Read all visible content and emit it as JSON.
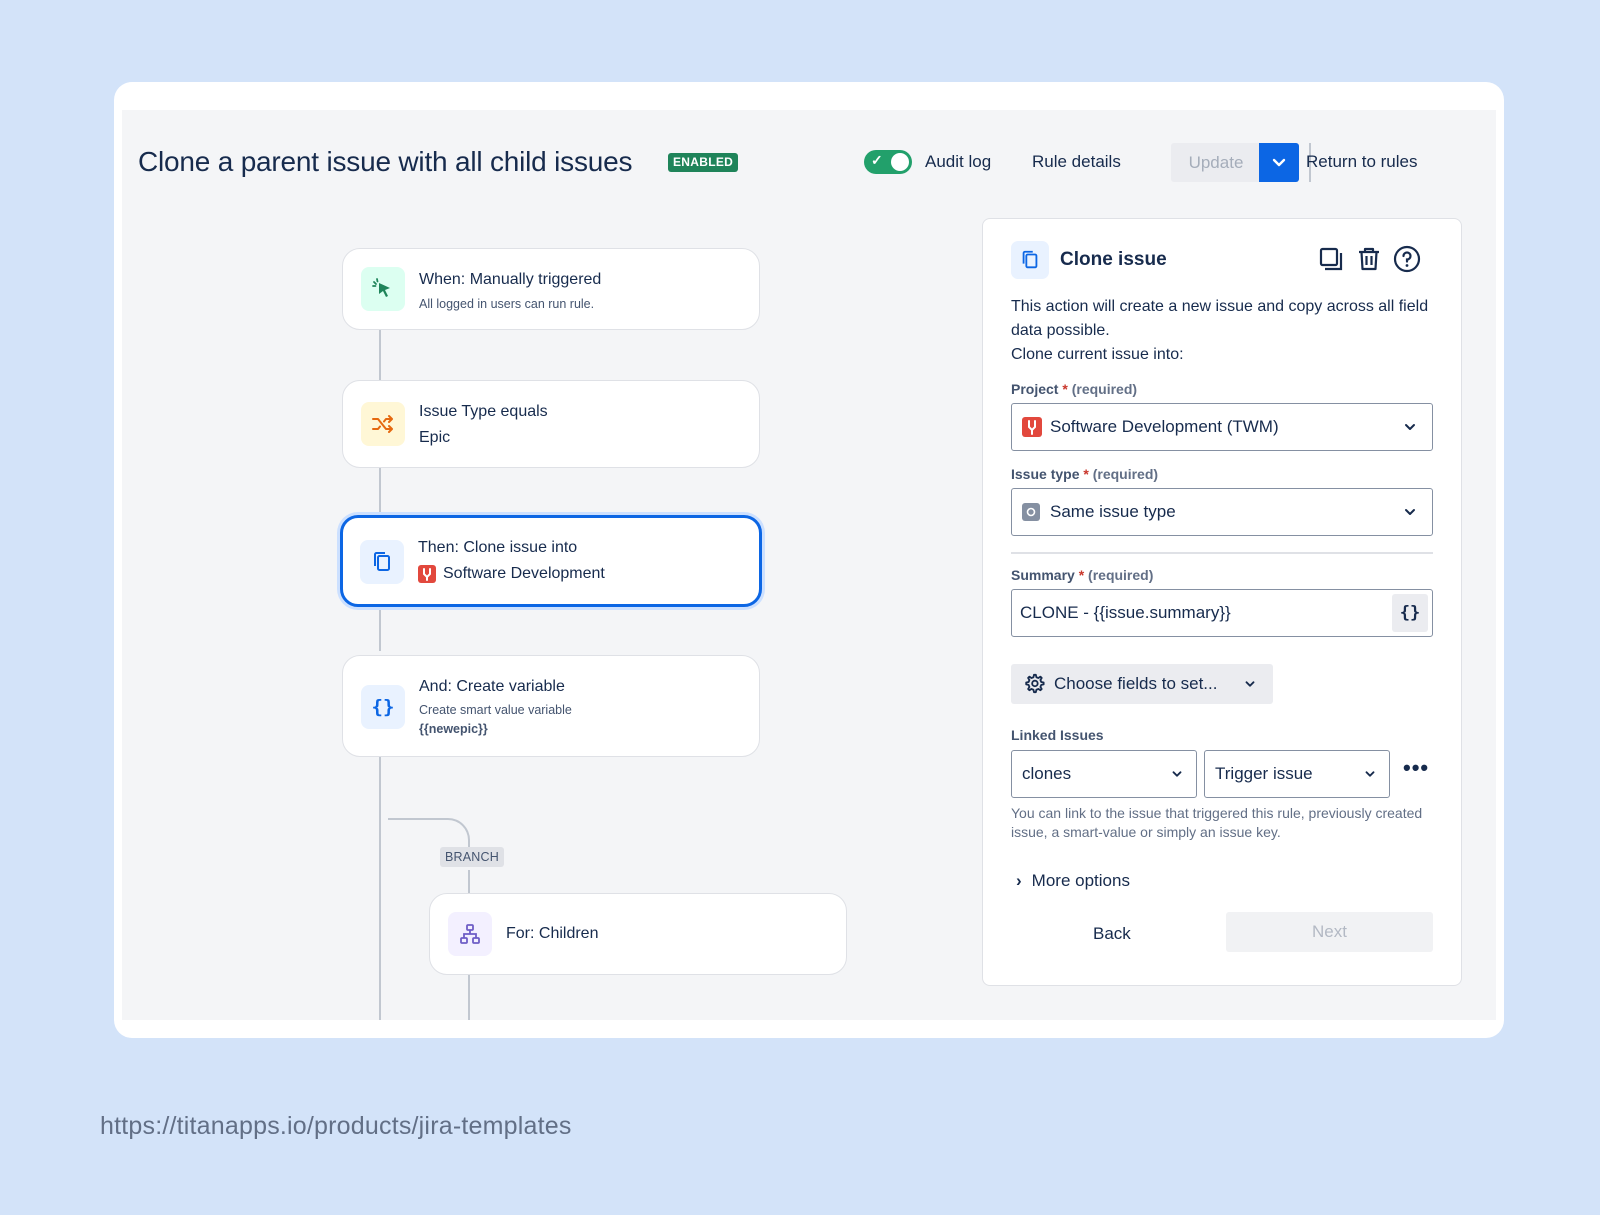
{
  "header": {
    "title": "Clone a parent issue with all child issues",
    "status_badge": "ENABLED",
    "audit_log": "Audit log",
    "rule_details": "Rule details",
    "update": "Update",
    "return_to_rules": "Return to rules",
    "toggle_on": true
  },
  "flow": {
    "trigger": {
      "title": "When: Manually triggered",
      "subtitle": "All logged in users can run rule."
    },
    "condition": {
      "title": "Issue Type equals",
      "value": "Epic"
    },
    "action": {
      "title": "Then: Clone issue into",
      "project": "Software Development"
    },
    "variable": {
      "title": "And: Create variable",
      "subtitle": "Create smart value variable",
      "value": "{{newepic}}"
    },
    "branch_label": "BRANCH",
    "branch": {
      "title": "For: Children"
    }
  },
  "panel": {
    "title": "Clone issue",
    "description_line1": "This action will create a new issue and copy across all field data possible.",
    "description_line2": "Clone current issue into:",
    "project_label": "Project",
    "required_text": "(required)",
    "project_value": "Software Development (TWM)",
    "issue_type_label": "Issue type",
    "issue_type_value": "Same issue type",
    "summary_label": "Summary",
    "summary_value": "CLONE - {{issue.summary}}",
    "smart_value_button": "{}",
    "choose_fields": "Choose fields to set...",
    "linked_issues_label": "Linked Issues",
    "link_type": "clones",
    "link_target": "Trigger issue",
    "more_actions": "•••",
    "help_text": "You can link to the issue that triggered this rule, previously created issue, a smart-value or simply an issue key.",
    "more_options": "More options",
    "back": "Back",
    "next": "Next"
  },
  "footer_url": "https://titanapps.io/products/jira-templates",
  "colors": {
    "background": "#d3e3f9",
    "accent": "#0c66e4",
    "enabled": "#1f845a",
    "toggle": "#22a06b"
  }
}
